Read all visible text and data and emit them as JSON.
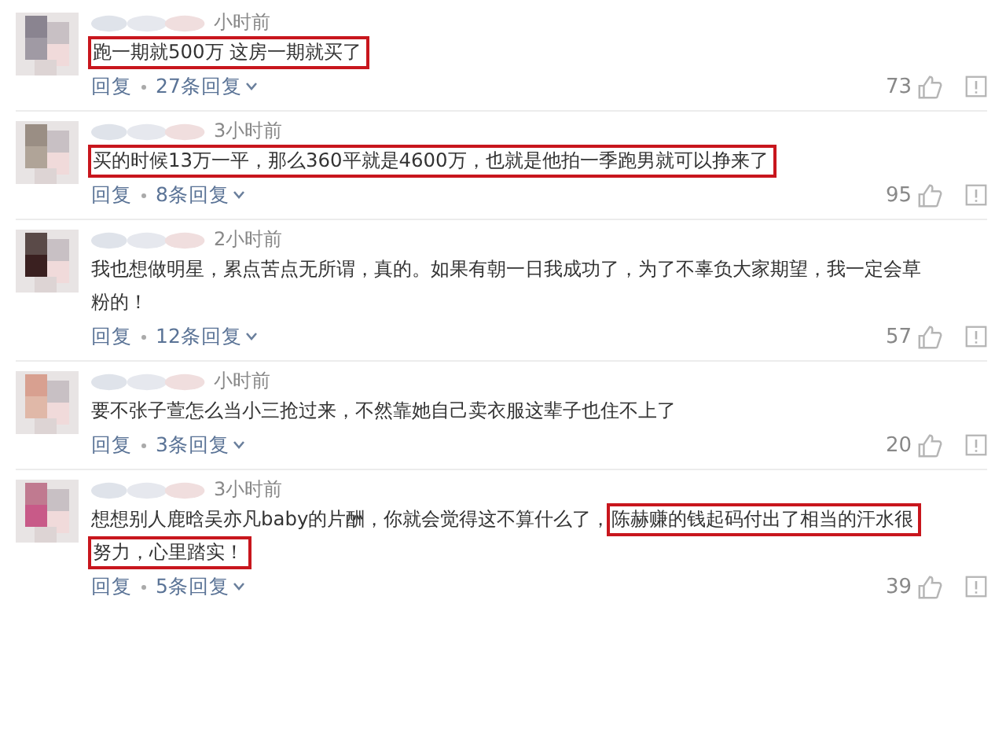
{
  "comments": [
    {
      "time": "小时前",
      "lines": [
        [
          {
            "text": "跑一期就500万 这房一期就买了",
            "highlighted": true
          }
        ]
      ],
      "reply": "回复",
      "reply_count": "27条回复",
      "likes": "73"
    },
    {
      "time": "3小时前",
      "lines": [
        [
          {
            "text": "买的时候13万一平，那么360平就是4600万，也就是他拍一季跑男就可以挣来了",
            "highlighted": true
          }
        ]
      ],
      "reply": "回复",
      "reply_count": "8条回复",
      "likes": "95"
    },
    {
      "time": "2小时前",
      "lines": [
        [
          {
            "text": "我也想做明星，累点苦点无所谓，真的。如果有朝一日我成功了，为了不辜负大家期望，我一定会草",
            "highlighted": false
          }
        ],
        [
          {
            "text": "粉的！",
            "highlighted": false
          }
        ]
      ],
      "reply": "回复",
      "reply_count": "12条回复",
      "likes": "57"
    },
    {
      "time": "小时前",
      "lines": [
        [
          {
            "text": "要不张子萱怎么当小三抢过来，不然靠她自己卖衣服这辈子也住不上了",
            "highlighted": false
          }
        ]
      ],
      "reply": "回复",
      "reply_count": "3条回复",
      "likes": "20"
    },
    {
      "time": "3小时前",
      "lines": [
        [
          {
            "text": "想想别人鹿晗吴亦凡baby的片酬，你就会觉得这不算什么了，",
            "highlighted": false
          },
          {
            "text": "陈赫赚的钱起码付出了相当的汗水很",
            "highlighted": true
          }
        ],
        [
          {
            "text": "努力，心里踏实！",
            "highlighted": true
          }
        ]
      ],
      "reply": "回复",
      "reply_count": "5条回复",
      "likes": "39"
    }
  ]
}
